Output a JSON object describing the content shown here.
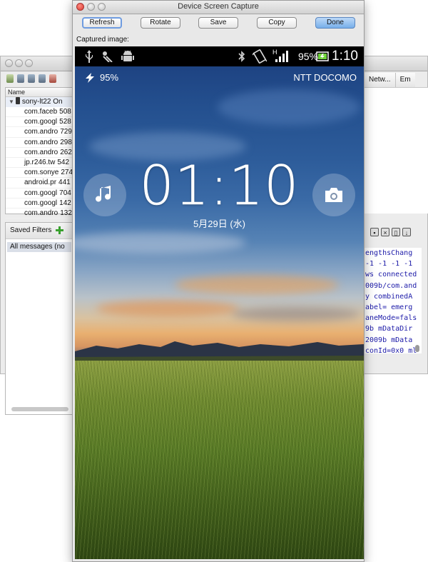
{
  "background_window": {
    "device_list": {
      "header": "Name",
      "device": "sony-lt22 On",
      "processes": [
        {
          "name": "com.faceb",
          "pid": "508"
        },
        {
          "name": "com.googl",
          "pid": "528"
        },
        {
          "name": "com.andro",
          "pid": "729"
        },
        {
          "name": "com.andro",
          "pid": "298"
        },
        {
          "name": "com.andro",
          "pid": "262"
        },
        {
          "name": "jp.r246.tw",
          "pid": "542"
        },
        {
          "name": "com.sonye",
          "pid": "274"
        },
        {
          "name": "android.pr",
          "pid": "441"
        },
        {
          "name": "com.googl",
          "pid": "704"
        },
        {
          "name": "com.googl",
          "pid": "142"
        },
        {
          "name": "com.andro",
          "pid": "132"
        }
      ]
    },
    "filters": {
      "title": "Saved Filters",
      "items": [
        "All messages (no"
      ]
    },
    "right_tabs": [
      "Netw...",
      "Em"
    ],
    "log_lines": [
      "engthsChang",
      " -1 -1 -1 -1",
      "ws connected",
      "009b/com.and",
      "y combinedA",
      "abel= emerg",
      "aneMode=fals",
      "9b mDataDir",
      "2009b mData",
      "conId=0x0 ml"
    ]
  },
  "dialog": {
    "title": "Device Screen Capture",
    "buttons": {
      "refresh": "Refresh",
      "rotate": "Rotate",
      "save": "Save",
      "copy": "Copy",
      "done": "Done"
    },
    "captured_label": "Captured image:"
  },
  "phone": {
    "status_bar": {
      "battery_percent": "95%",
      "time": "1:10",
      "network_type": "H"
    },
    "lockscreen": {
      "battery_percent": "95%",
      "carrier": "NTT DOCOMO",
      "clock": "01:10",
      "date": "5月29日 (水)"
    }
  }
}
